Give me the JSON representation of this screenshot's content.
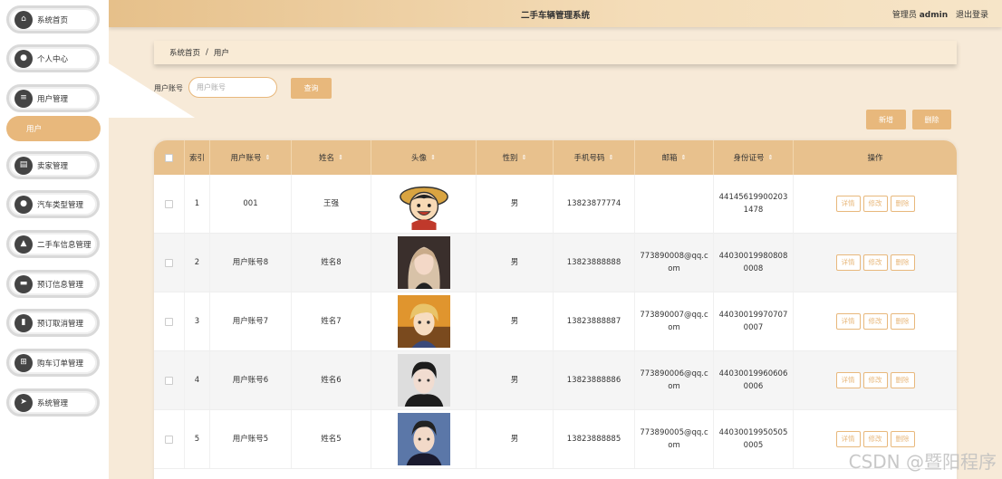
{
  "sidebar": {
    "items": [
      {
        "label": "系统首页",
        "icon": "home-icon",
        "glyph": "⌂"
      },
      {
        "label": "个人中心",
        "icon": "person-icon",
        "glyph": "●"
      },
      {
        "label": "用户管理",
        "icon": "list-icon",
        "glyph": "≡"
      },
      {
        "label": "卖家管理",
        "icon": "briefcase-icon",
        "glyph": "▤"
      },
      {
        "label": "汽车类型管理",
        "icon": "person-icon",
        "glyph": "●"
      },
      {
        "label": "二手车信息管理",
        "icon": "thumbs-up-icon",
        "glyph": "▲"
      },
      {
        "label": "预订信息管理",
        "icon": "message-icon",
        "glyph": "▬"
      },
      {
        "label": "预订取消管理",
        "icon": "bar-chart-icon",
        "glyph": "▮"
      },
      {
        "label": "购车订单管理",
        "icon": "grid-icon",
        "glyph": "⊞"
      },
      {
        "label": "系统管理",
        "icon": "send-icon",
        "glyph": "➤"
      }
    ],
    "submenu_label": "用户"
  },
  "header": {
    "title": "二手车辆管理系统",
    "user_prefix": "管理员",
    "username": "admin",
    "logout": "退出登录"
  },
  "breadcrumb": {
    "home": "系统首页",
    "sep": "/",
    "current": "用户"
  },
  "search": {
    "label": "用户账号",
    "placeholder": "用户账号",
    "button": "查询"
  },
  "actions": {
    "add": "新增",
    "delete": "删除"
  },
  "table": {
    "headers": [
      "索引",
      "用户账号",
      "姓名",
      "头像",
      "性别",
      "手机号码",
      "邮箱",
      "身份证号",
      "操作"
    ],
    "sort_glyph": "⇕",
    "ops": {
      "detail": "详情",
      "edit": "修改",
      "delete": "删除"
    },
    "rows": [
      {
        "index": "1",
        "account": "001",
        "name": "王强",
        "avatar": "cartoon-boy",
        "gender": "男",
        "phone": "13823877774",
        "email": "",
        "id_card": "441456199002031478"
      },
      {
        "index": "2",
        "account": "用户账号8",
        "name": "姓名8",
        "avatar": "woman-portrait",
        "gender": "男",
        "phone": "13823888888",
        "email": "773890008@qq.com",
        "id_card": "440300199808080008"
      },
      {
        "index": "3",
        "account": "用户账号7",
        "name": "姓名7",
        "avatar": "anime-boy",
        "gender": "男",
        "phone": "13823888887",
        "email": "773890007@qq.com",
        "id_card": "440300199707070007"
      },
      {
        "index": "4",
        "account": "用户账号6",
        "name": "姓名6",
        "avatar": "man-portrait-dark",
        "gender": "男",
        "phone": "13823888886",
        "email": "773890006@qq.com",
        "id_card": "440300199606060006"
      },
      {
        "index": "5",
        "account": "用户账号5",
        "name": "姓名5",
        "avatar": "man-portrait-blue",
        "gender": "男",
        "phone": "13823888885",
        "email": "773890005@qq.com",
        "id_card": "440300199505050005"
      }
    ]
  },
  "watermark": "CSDN @暨阳程序",
  "colors": {
    "accent": "#e8b87c",
    "background": "#f7ead8",
    "header_row": "#e8c18d"
  }
}
